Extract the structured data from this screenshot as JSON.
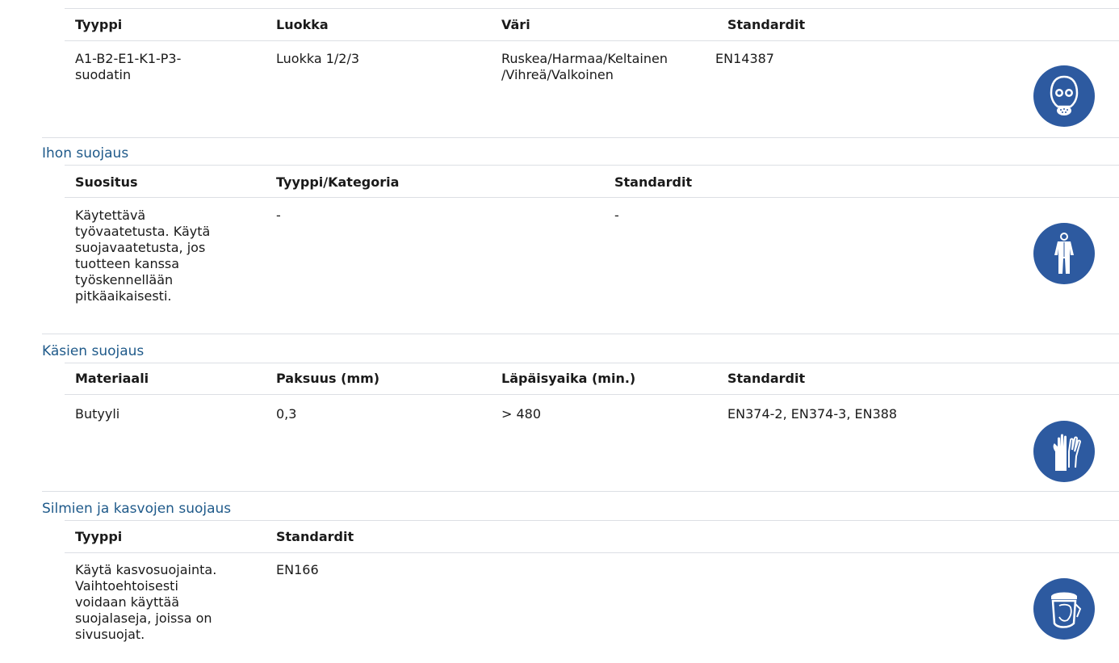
{
  "respiratory": {
    "headers": [
      "Tyyppi",
      "Luokka",
      "Väri",
      "Standardit"
    ],
    "type": "A1-B2-E1-K1-P3-\nsuodatin",
    "class": "Luokka 1/2/3",
    "color": "Ruskea/Harmaa/Keltainen\n/Vihreä/Valkoinen",
    "standard": "EN14387",
    "icon": "respirator-mask-icon"
  },
  "skin": {
    "title": "Ihon suojaus",
    "headers": [
      "Suositus",
      "Tyyppi/Kategoria",
      "Standardit"
    ],
    "recommendation": "Käytettävä\ntyövaatetusta. Käytä\nsuojavaatetusta, jos\ntuotteen kanssa\ntyöskennellään\npitkäaikaisesti.",
    "category": "-",
    "standard": "-",
    "icon": "protective-clothing-icon"
  },
  "hands": {
    "title": "Käsien suojaus",
    "headers": [
      "Materiaali",
      "Paksuus (mm)",
      "Läpäisyaika (min.)",
      "Standardit"
    ],
    "material": "Butyyli",
    "thickness": "0,3",
    "breakthrough": "> 480",
    "standard": "EN374-2, EN374-3, EN388",
    "icon": "gloves-icon"
  },
  "eyes": {
    "title": "Silmien ja kasvojen suojaus",
    "headers": [
      "Tyyppi",
      "Standardit"
    ],
    "type": "Käytä kasvosuojainta.\nVaihtoehtoisesti\nvoidaan käyttää\nsuojalaseja, joissa on\nsivusuojat.",
    "standard": "EN166",
    "icon": "face-shield-icon"
  },
  "colors": {
    "accent": "#1f5a8a",
    "icon_bg": "#2d5aa0",
    "divider": "#dcdfe4"
  }
}
